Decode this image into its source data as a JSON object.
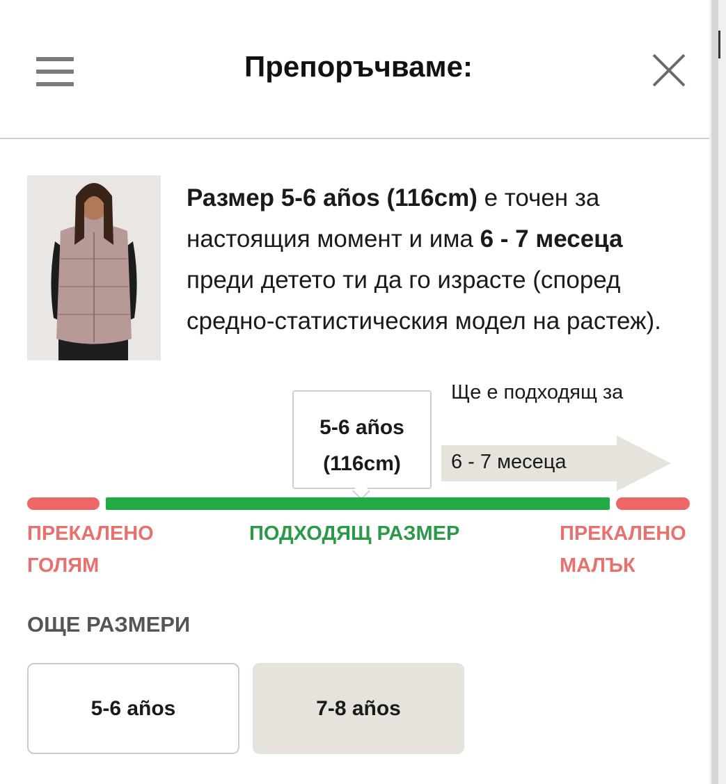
{
  "header": {
    "title": "Препоръчваме:",
    "menu_icon": "hamburger-menu-icon",
    "close_icon": "close-x-icon"
  },
  "recommendation": {
    "size_bold": "Размер 5-6 años (116cm)",
    "text_1": " е точен за настоящия момент и има ",
    "months_bold": "6 - 7 месеца",
    "text_2": " преди детето ти да го израсте (според средно-статистическия модел на растеж)."
  },
  "callout": {
    "line1": "5-6 años",
    "line2": "(116cm)"
  },
  "fit": {
    "caption": "Ще е подходящ за",
    "months": "6 - 7 месеца"
  },
  "zones": {
    "too_big": "ПРЕКАЛЕНО ГОЛЯМ",
    "fits": "ПОДХОДЯЩ РАЗМЕР",
    "too_small": "ПРЕКАЛЕНО МАЛЪК"
  },
  "more_sizes": {
    "title": "ОЩЕ РАЗМЕРИ",
    "options": [
      {
        "label": "5-6 años",
        "selected": true
      },
      {
        "label": "7-8 años",
        "selected": false
      }
    ]
  },
  "colors": {
    "fit_green": "#22aa44",
    "warn_red": "#ee6666",
    "arrow_beige": "#e6e2dc"
  }
}
